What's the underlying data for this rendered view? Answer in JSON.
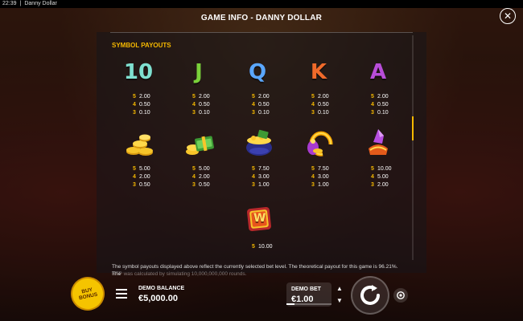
{
  "status_bar": {
    "time": "22:39",
    "separator": "|",
    "app_name": "Danny Dollar"
  },
  "header": {
    "title": "GAME INFO - DANNY DOLLAR",
    "close_icon": "close-icon"
  },
  "section": {
    "title": "SYMBOL PAYOUTS"
  },
  "colors": {
    "accent": "#f5b800",
    "button_yellow": "#f5c400"
  },
  "symbols": [
    {
      "name": "10",
      "icon": "ten-symbol",
      "color": "#7fe0d0",
      "payouts": [
        {
          "count": "5",
          "value": "2.00"
        },
        {
          "count": "4",
          "value": "0.50"
        },
        {
          "count": "3",
          "value": "0.10"
        }
      ]
    },
    {
      "name": "J",
      "icon": "j-symbol",
      "color": "#7ad13a",
      "payouts": [
        {
          "count": "5",
          "value": "2.00"
        },
        {
          "count": "4",
          "value": "0.50"
        },
        {
          "count": "3",
          "value": "0.10"
        }
      ]
    },
    {
      "name": "Q",
      "icon": "q-symbol",
      "color": "#5aa7ff",
      "payouts": [
        {
          "count": "5",
          "value": "2.00"
        },
        {
          "count": "4",
          "value": "0.50"
        },
        {
          "count": "3",
          "value": "0.10"
        }
      ]
    },
    {
      "name": "K",
      "icon": "k-symbol",
      "color": "#f06a2a",
      "payouts": [
        {
          "count": "5",
          "value": "2.00"
        },
        {
          "count": "4",
          "value": "0.50"
        },
        {
          "count": "3",
          "value": "0.10"
        }
      ]
    },
    {
      "name": "A",
      "icon": "a-symbol",
      "color": "#b84dd8",
      "payouts": [
        {
          "count": "5",
          "value": "2.00"
        },
        {
          "count": "4",
          "value": "0.50"
        },
        {
          "count": "3",
          "value": "0.10"
        }
      ]
    },
    {
      "icon": "gold-coins-icon",
      "payouts": [
        {
          "count": "5",
          "value": "5.00"
        },
        {
          "count": "4",
          "value": "2.00"
        },
        {
          "count": "3",
          "value": "0.50"
        }
      ]
    },
    {
      "icon": "cash-stack-icon",
      "payouts": [
        {
          "count": "5",
          "value": "5.00"
        },
        {
          "count": "4",
          "value": "2.00"
        },
        {
          "count": "3",
          "value": "0.50"
        }
      ]
    },
    {
      "icon": "pot-of-gold-icon",
      "payouts": [
        {
          "count": "5",
          "value": "7.50"
        },
        {
          "count": "4",
          "value": "3.00"
        },
        {
          "count": "3",
          "value": "1.00"
        }
      ]
    },
    {
      "icon": "horseshoe-icon",
      "payouts": [
        {
          "count": "5",
          "value": "7.50"
        },
        {
          "count": "4",
          "value": "3.00"
        },
        {
          "count": "3",
          "value": "1.00"
        }
      ]
    },
    {
      "icon": "gem-icon",
      "payouts": [
        {
          "count": "5",
          "value": "10.00"
        },
        {
          "count": "4",
          "value": "5.00"
        },
        {
          "count": "3",
          "value": "2.00"
        }
      ]
    },
    {
      "name": "W",
      "icon": "wild-icon",
      "payouts": [
        {
          "count": "5",
          "value": "10.00"
        }
      ]
    }
  ],
  "info_text": "The symbol payouts displayed above reflect the currently selected bet level. The theoretical payout for this game is 96.21%. The",
  "info_text_2": "RTP was calculated by simulating 10,000,000,000 rounds.",
  "footer": {
    "buy_bonus": {
      "line1": "BUY",
      "line2": "BONUS"
    },
    "balance_label": "DEMO BALANCE",
    "balance_value": "€5,000.00",
    "bet_label": "DEMO BET",
    "bet_value": "€1.00",
    "menu_icon": "hamburger-menu-icon",
    "spin_icon": "spin-icon",
    "autoplay_icon": "autoplay-icon"
  }
}
